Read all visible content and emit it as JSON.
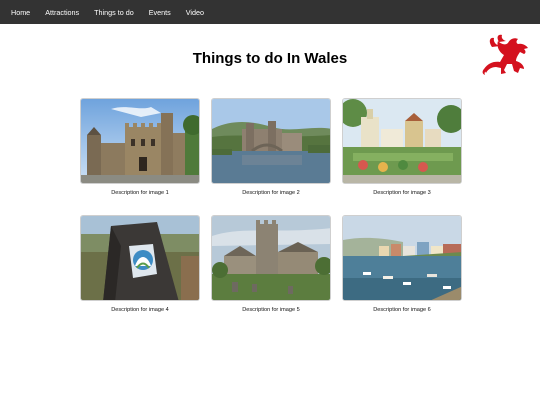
{
  "nav": {
    "items": [
      "Home",
      "Attractions",
      "Things to do",
      "Events",
      "Video"
    ]
  },
  "page": {
    "title": "Things to do In Wales"
  },
  "logo": {
    "icon": "welsh-dragon-icon",
    "color": "#d4111e"
  },
  "gallery": {
    "captions": [
      "Description for image 1",
      "Description for image 2",
      "Description for image 3",
      "Description for image 4",
      "Description for image 5",
      "Description for image 6"
    ]
  }
}
